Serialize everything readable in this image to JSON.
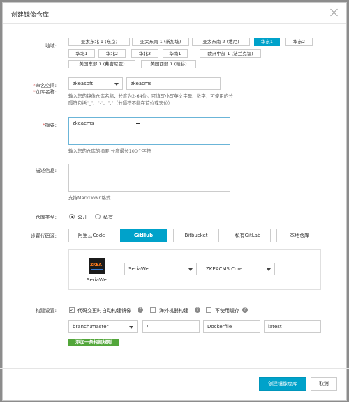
{
  "dialog": {
    "title": "创建镜像仓库"
  },
  "region": {
    "label": "地域:",
    "options": [
      "亚太东北 1 (东京)",
      "亚太东南 1 (新加坡)",
      "亚太东南 2 (悉尼)",
      "华东1",
      "华东2",
      "华北1",
      "华北2",
      "华北3",
      "华南1",
      "欧洲中部 1 (法兰克福)",
      "美国东部 1 (弗吉尼亚)",
      "美国西部 1 (硅谷)"
    ],
    "selected": "华东1"
  },
  "namespace": {
    "label": "命名空间:",
    "value": "zkeasoft"
  },
  "repo_name": {
    "label": "仓库名称:",
    "value": "zkeacms",
    "hint": "输入您的镜像仓库名称，长度为2-64位。可填写小写英文字母、数字，可使用的分隔符包括\"_\"、\"-\"、\".\"（分隔符不能在首位或末位）"
  },
  "summary": {
    "label": "摘要:",
    "value": "zkeacms",
    "hint": "输入您的仓库的摘要,长度最长100个字符"
  },
  "description": {
    "label": "描述信息:",
    "value": "",
    "hint": "支持MarkDown格式"
  },
  "repo_type": {
    "label": "仓库类型:",
    "options": [
      "公开",
      "私有"
    ],
    "selected": "公开"
  },
  "code_source": {
    "label": "设置代码源:",
    "options": [
      "阿里云Code",
      "GitHub",
      "Bitbucket",
      "私有GitLab",
      "本地仓库"
    ],
    "selected": "GitHub",
    "account_logo": "ZKEA",
    "account_name": "SeriaWei",
    "org_select": "SeriaWei",
    "repo_select": "ZKEACMS.Core"
  },
  "build": {
    "label": "构建设置:",
    "auto_build": {
      "label": "代码变更时自动构建镜像",
      "checked": true
    },
    "overseas_build": {
      "label": "海外机器构建",
      "checked": false
    },
    "no_cache": {
      "label": "不使用缓存",
      "checked": false
    },
    "rule": {
      "branch": "branch:master",
      "dir": "/",
      "dockerfile": "Dockerfile",
      "tag": "latest"
    },
    "add_rule_label": "添加一条构建规则"
  },
  "footer": {
    "create_label": "创建镜像仓库",
    "cancel_label": "取消"
  },
  "colors": {
    "primary": "#00a2ca",
    "add_rule": "#52a63a",
    "required": "#d9534f"
  }
}
